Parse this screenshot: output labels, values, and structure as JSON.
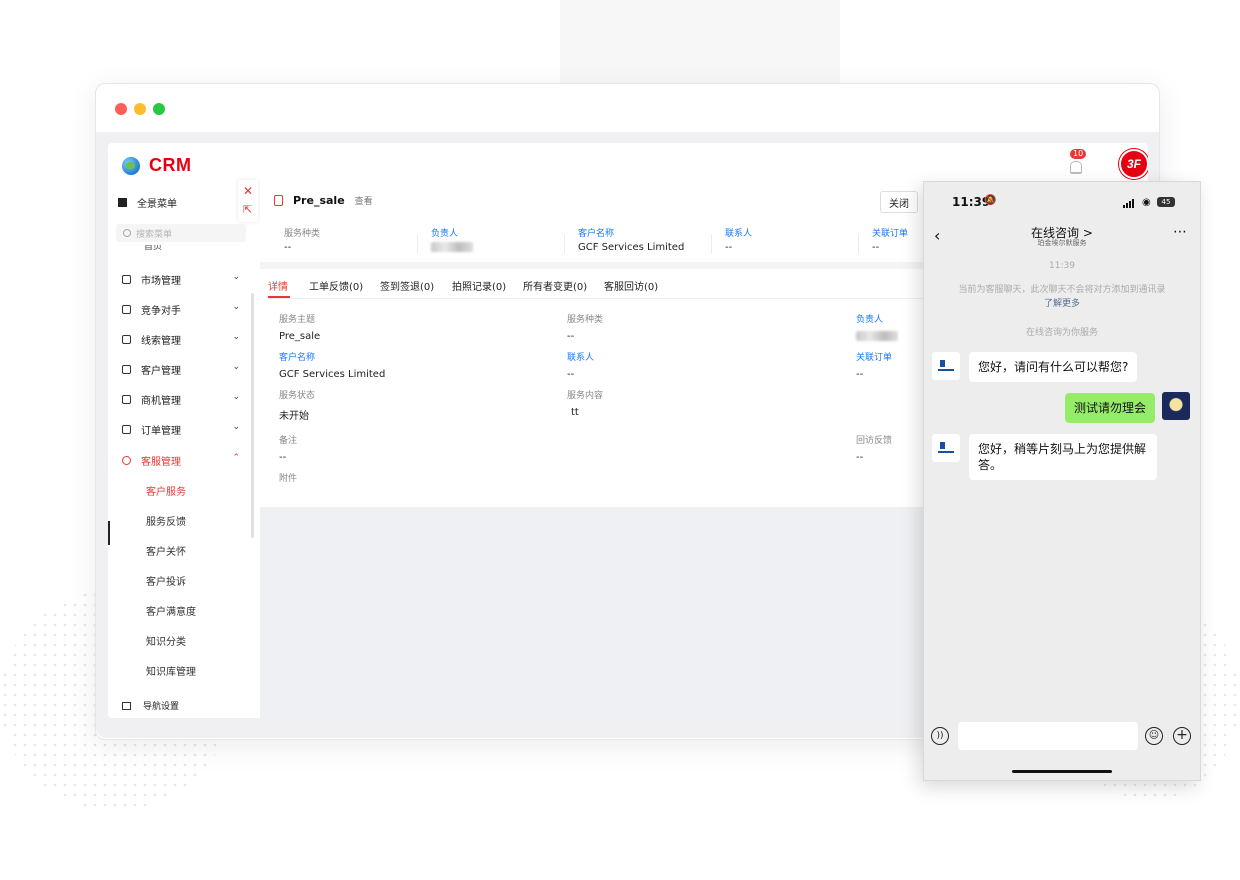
{
  "app": {
    "logo_text": "CRM",
    "notification_count": "10",
    "avatar_text": "3F"
  },
  "sidebar": {
    "menu_all": "全景菜单",
    "search_placeholder": "搜索菜单",
    "cut_item": "首页",
    "items": [
      {
        "label": "市场管理",
        "icon": "megaphone-icon"
      },
      {
        "label": "竞争对手",
        "icon": "competitor-icon"
      },
      {
        "label": "线索管理",
        "icon": "lead-icon"
      },
      {
        "label": "客户管理",
        "icon": "customer-icon"
      },
      {
        "label": "商机管理",
        "icon": "briefcase-icon"
      },
      {
        "label": "订单管理",
        "icon": "order-icon"
      },
      {
        "label": "客服管理",
        "icon": "headset-icon"
      }
    ],
    "sub_items": [
      "客户服务",
      "服务反馈",
      "客户关怀",
      "客户投诉",
      "客户满意度",
      "知识分类",
      "知识库管理"
    ],
    "bottom": "导航设置"
  },
  "panel": {
    "title": "Pre_sale",
    "view_label": "查看",
    "close_label": "关闭",
    "summary": {
      "service_type_label": "服务种类",
      "service_type_value": "--",
      "owner_label": "负责人",
      "customer_label": "客户名称",
      "customer_value": "GCF Services Limited",
      "contact_label": "联系人",
      "contact_value": "--",
      "order_label": "关联订单",
      "order_value": "--"
    },
    "tabs": [
      "详情",
      "工单反馈(0)",
      "签到签退(0)",
      "拍照记录(0)",
      "所有者变更(0)",
      "客服回访(0)"
    ],
    "detail": {
      "subject_label": "服务主题",
      "subject_value": "Pre_sale",
      "type_label": "服务种类",
      "type_value": "--",
      "owner_label": "负责人",
      "customer_label": "客户名称",
      "customer_value": "GCF Services Limited",
      "contact_label": "联系人",
      "contact_value": "--",
      "order_label": "关联订单",
      "order_value": "--",
      "status_label": "服务状态",
      "status_value": "未开始",
      "content_label": "服务内容",
      "content_value": "tt",
      "remark_label": "备注",
      "remark_value": "--",
      "feedback_label": "回访反馈",
      "feedback_value": "--",
      "attachment_label": "附件"
    }
  },
  "phone": {
    "time": "11:39",
    "battery": "45",
    "title": "在线咨询",
    "title_chevron": ">",
    "subtitle": "珀金埃尔默服务",
    "stamp": "11:39",
    "notice_text": "当前为客服聊天，此次聊天不会将对方添加到通讯录",
    "notice_link": "了解更多",
    "service_notice": "在线咨询为你服务",
    "messages": [
      {
        "from": "agent",
        "text": "您好，请问有什么可以帮您?"
      },
      {
        "from": "user",
        "text": "测试请勿理会"
      },
      {
        "from": "agent",
        "text": "您好，稍等片刻马上为您提供解答。"
      }
    ]
  },
  "colors": {
    "brand_red": "#e60012",
    "accent_red": "#e53935",
    "link_blue": "#1677ff",
    "wechat_green": "#95ec69"
  }
}
